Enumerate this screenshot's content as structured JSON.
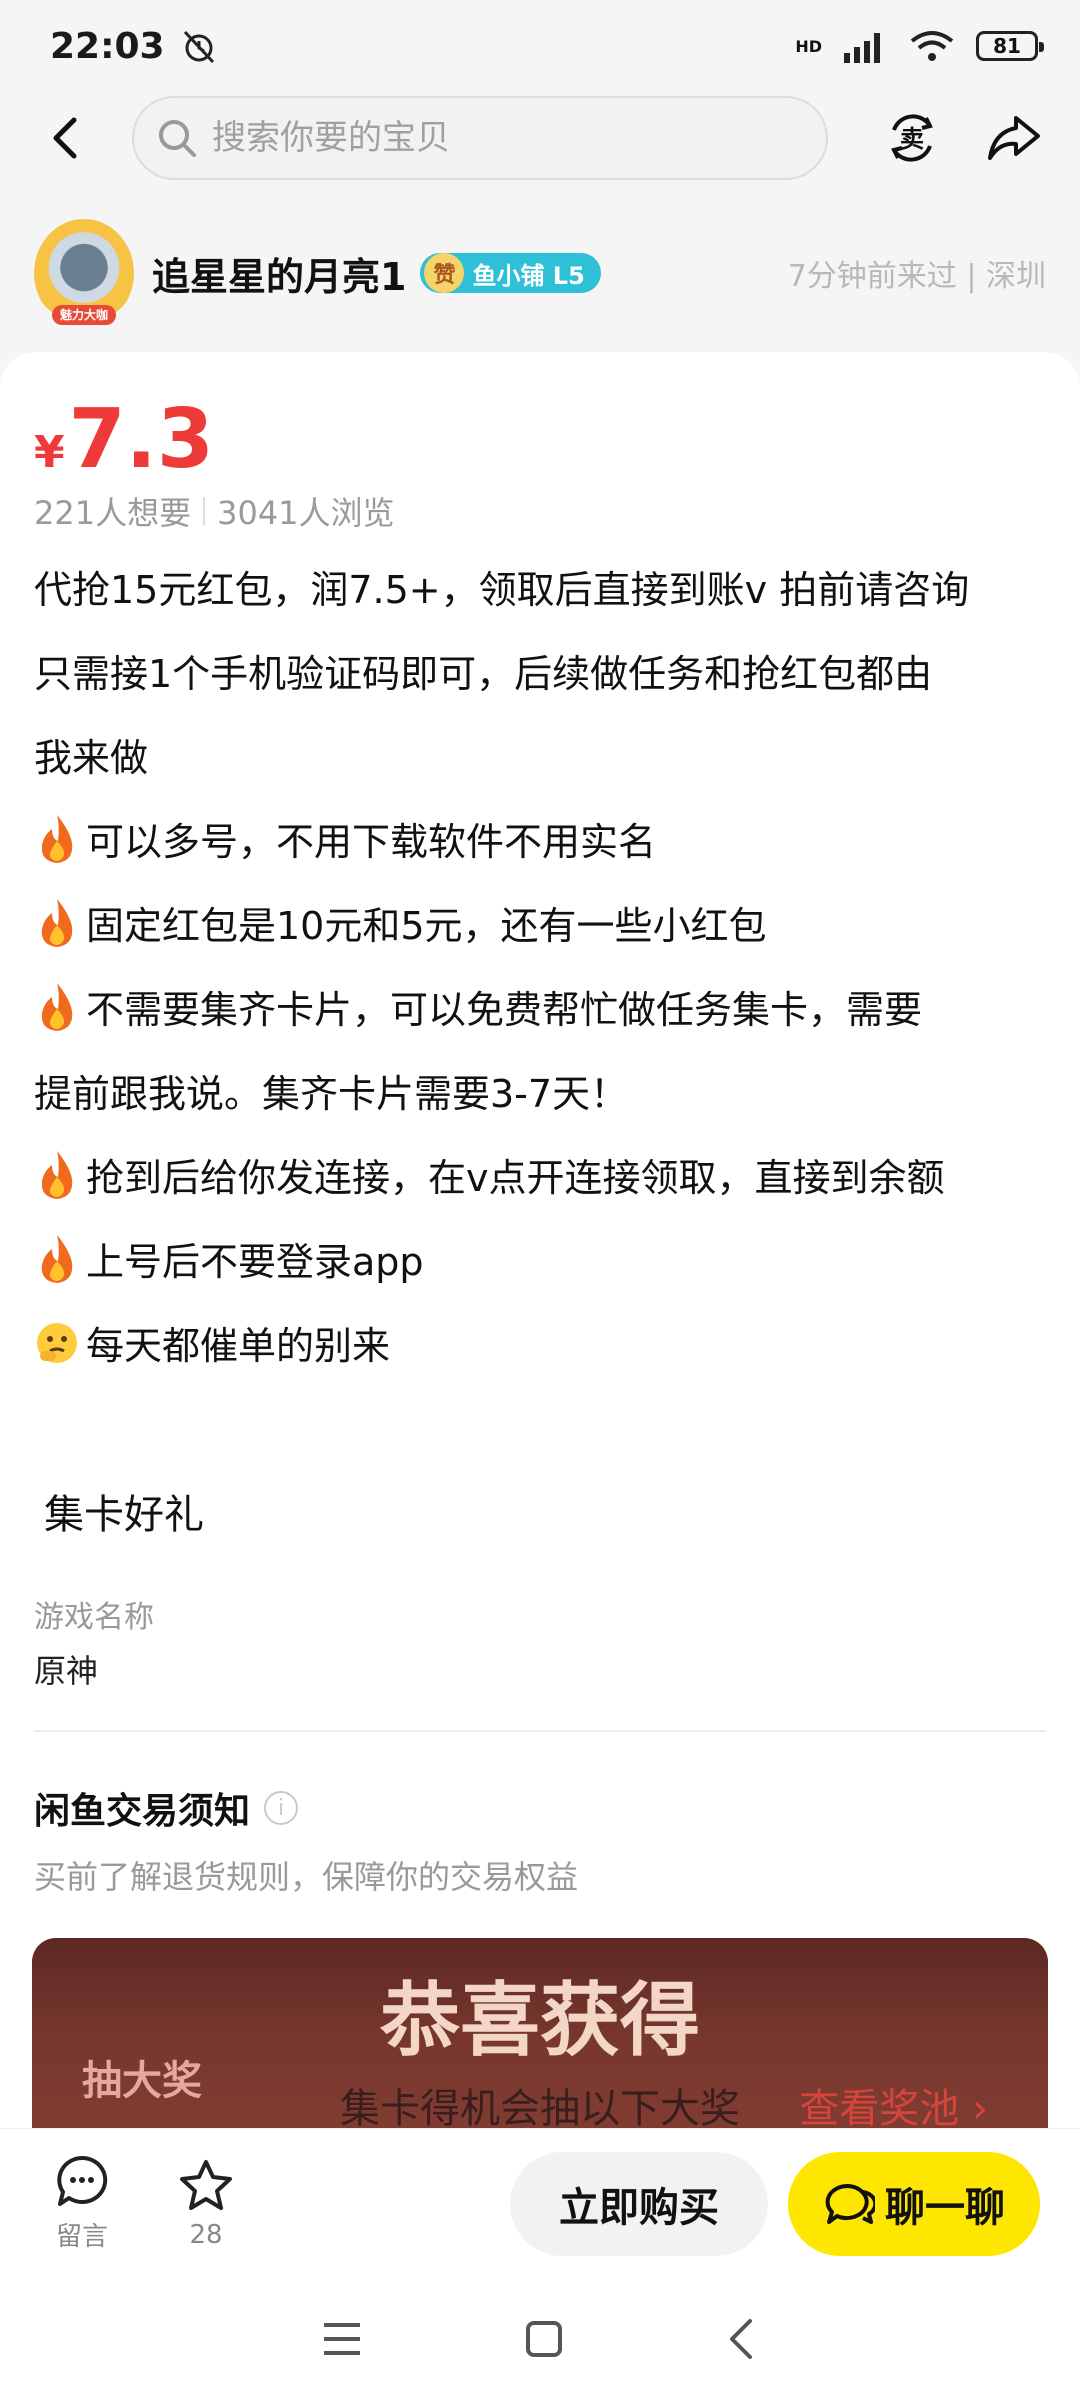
{
  "status": {
    "time": "22:03",
    "battery": "81",
    "network": "HD"
  },
  "nav": {
    "search_placeholder": "搜索你要的宝贝",
    "icons": [
      "back-icon",
      "search-icon",
      "sell-icon",
      "share-icon"
    ]
  },
  "seller": {
    "name": "追星星的月亮1",
    "avatar_badge": "魅力大咖",
    "zan": "赞",
    "level": "鱼小铺 L5",
    "meta": "7分钟前来过 | 深圳"
  },
  "item": {
    "currency": "¥",
    "price": "7.3",
    "wants": "221人想要",
    "views": "3041人浏览",
    "desc": [
      "代抢15元红包，润7.5+，领取后直接到账v 拍前请咨询",
      "只需接1个手机验证码即可，后续做任务和抢红包都由",
      "我来做"
    ],
    "bullets": [
      "可以多号，不用下载软件不用实名",
      "固定红包是10元和5元，还有一些小红包",
      "不需要集齐卡片，可以免费帮忙做任务集卡，需要",
      "提前跟我说。集齐卡片需要3-7天！",
      "抢到后给你发连接，在v点开连接领取，直接到余额",
      "上号后不要登录app",
      "每天都催单的别来"
    ],
    "section_title": "集卡好礼",
    "field_label": "游戏名称",
    "field_value": "原神",
    "notice_title": "闲鱼交易须知",
    "notice_info": "i",
    "notice_sub": "买前了解退货规则，保障你的交易权益"
  },
  "banner": {
    "title": "恭喜获得",
    "left": "抽大奖",
    "mid": "集卡得机会抽以下大奖",
    "right": "查看奖池 ›"
  },
  "bottom": {
    "comment_label": "留言",
    "fav_count": "28",
    "buy_label": "立即购买",
    "chat_label": "聊一聊"
  },
  "colors": {
    "price": "#ef3a3a",
    "chat_button": "#ffe600",
    "level_badge": "#2ec0d6"
  }
}
